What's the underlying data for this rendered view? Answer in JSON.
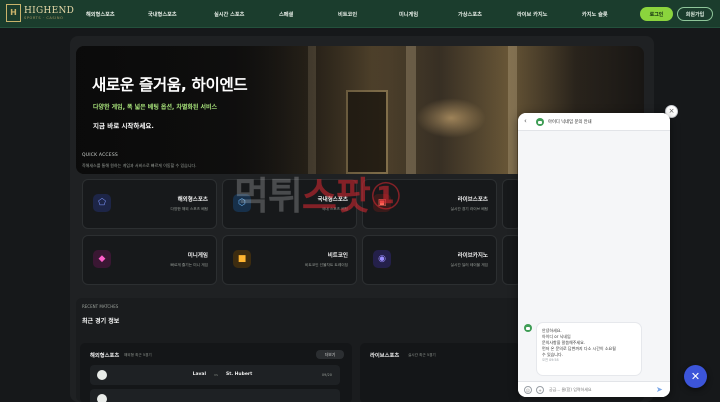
{
  "brand": {
    "logo_mark": "H",
    "name": "HIGHEND",
    "tagline": "SPORTS · CASINO"
  },
  "nav": {
    "items": [
      "해외형스포츠",
      "국내형스포츠",
      "실시간 스포츠",
      "스페셜",
      "비트코인",
      "미니게임",
      "가상스포츠",
      "라이브 카지노",
      "카지노 슬롯"
    ],
    "login_label": "로그인",
    "signup_label": "회원가입"
  },
  "hero": {
    "title": "새로운 즐거움, 하이엔드",
    "subtitle": "다양한 게임, 폭 넓은 베팅 옵션, 차별화된 서비스",
    "cta": "지금 바로 시작하세요."
  },
  "quick_access": {
    "label": "QUICK ACCESS",
    "description": "즉해새스를 통해 원하는 게임과 서비스로 빠르게 이동할 수 있습니다.",
    "cards": [
      {
        "name": "해외형스포츠",
        "desc": "다양한 해외 스포츠 베팅",
        "icon": "soccer-ball-icon",
        "color": "#4a6cf0"
      },
      {
        "name": "국내형스포츠",
        "desc": "국내 스포츠 베팅",
        "icon": "soccer-ball-icon",
        "color": "#2f7fcf"
      },
      {
        "name": "라이브스포츠",
        "desc": "실시간 경기 라이브 베팅",
        "icon": "tv-icon",
        "color": "#c0392b"
      },
      {
        "name": "미니게임",
        "desc": "빠르게 즐기는 미니 게임",
        "icon": "cube-icon",
        "color": "#e24fb4"
      },
      {
        "name": "비트코인",
        "desc": "비트코인 선물차트 트레이딩",
        "icon": "chat-icon",
        "color": "#f0a21a"
      },
      {
        "name": "라이브카지노",
        "desc": "실시간 딜러 테이블 게임",
        "icon": "gamepad-icon",
        "color": "#5b53c8"
      }
    ]
  },
  "watermark": {
    "part1": "먹튀",
    "part2": "스팟",
    "part3": "①"
  },
  "recent": {
    "label": "RECENT MATCHES",
    "title": "최근 경기 정보",
    "overseas": {
      "title": "해외형스포츠",
      "sub": "해외형 최근 5경기",
      "view_all": "더보기",
      "match": {
        "home": "Laval",
        "vs": "vs",
        "away": "St. Hubert",
        "date": "09/20"
      }
    },
    "live": {
      "title": "라이브스포츠",
      "sub": "실시간 최근 5경기"
    }
  },
  "chat": {
    "title": "아이디 닉네임 문의 안내",
    "bubble_lines": [
      "안녕하세요.",
      "아이디 or 닉네임",
      "문의사항을 말씀해주세요.",
      "먼저 온 문의로 답변까지 다소 시간이 소요될",
      "수 있습니다."
    ],
    "time": "오전 09:58",
    "input_placeholder": "궁금... 물(함) 입력하세요"
  },
  "controls": {
    "close": "×",
    "fab": "✕"
  }
}
